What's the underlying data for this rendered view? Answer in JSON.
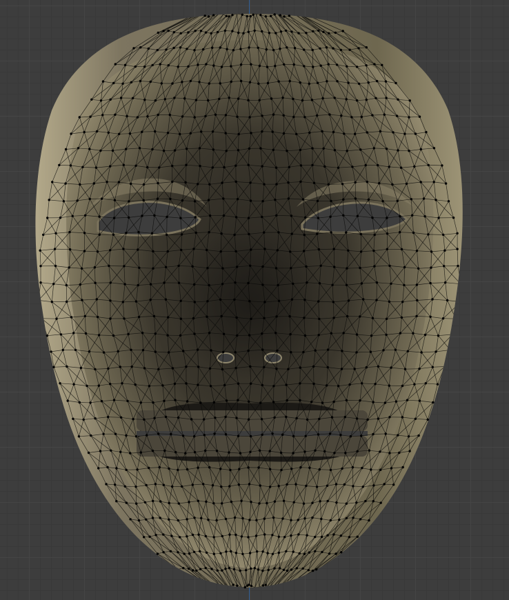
{
  "viewport": {
    "mode": "edit-mode",
    "object_name": "mask",
    "shading": "material-preview",
    "axis_color": "#2e5f9c",
    "grid_color": "#454545",
    "background_color": "#3d3d3d"
  },
  "mesh": {
    "surface_color_light": "#a49a7c",
    "surface_color_dark": "#2e2a22",
    "wire_color": "#0a0a08",
    "vertex_color": "#000000"
  }
}
